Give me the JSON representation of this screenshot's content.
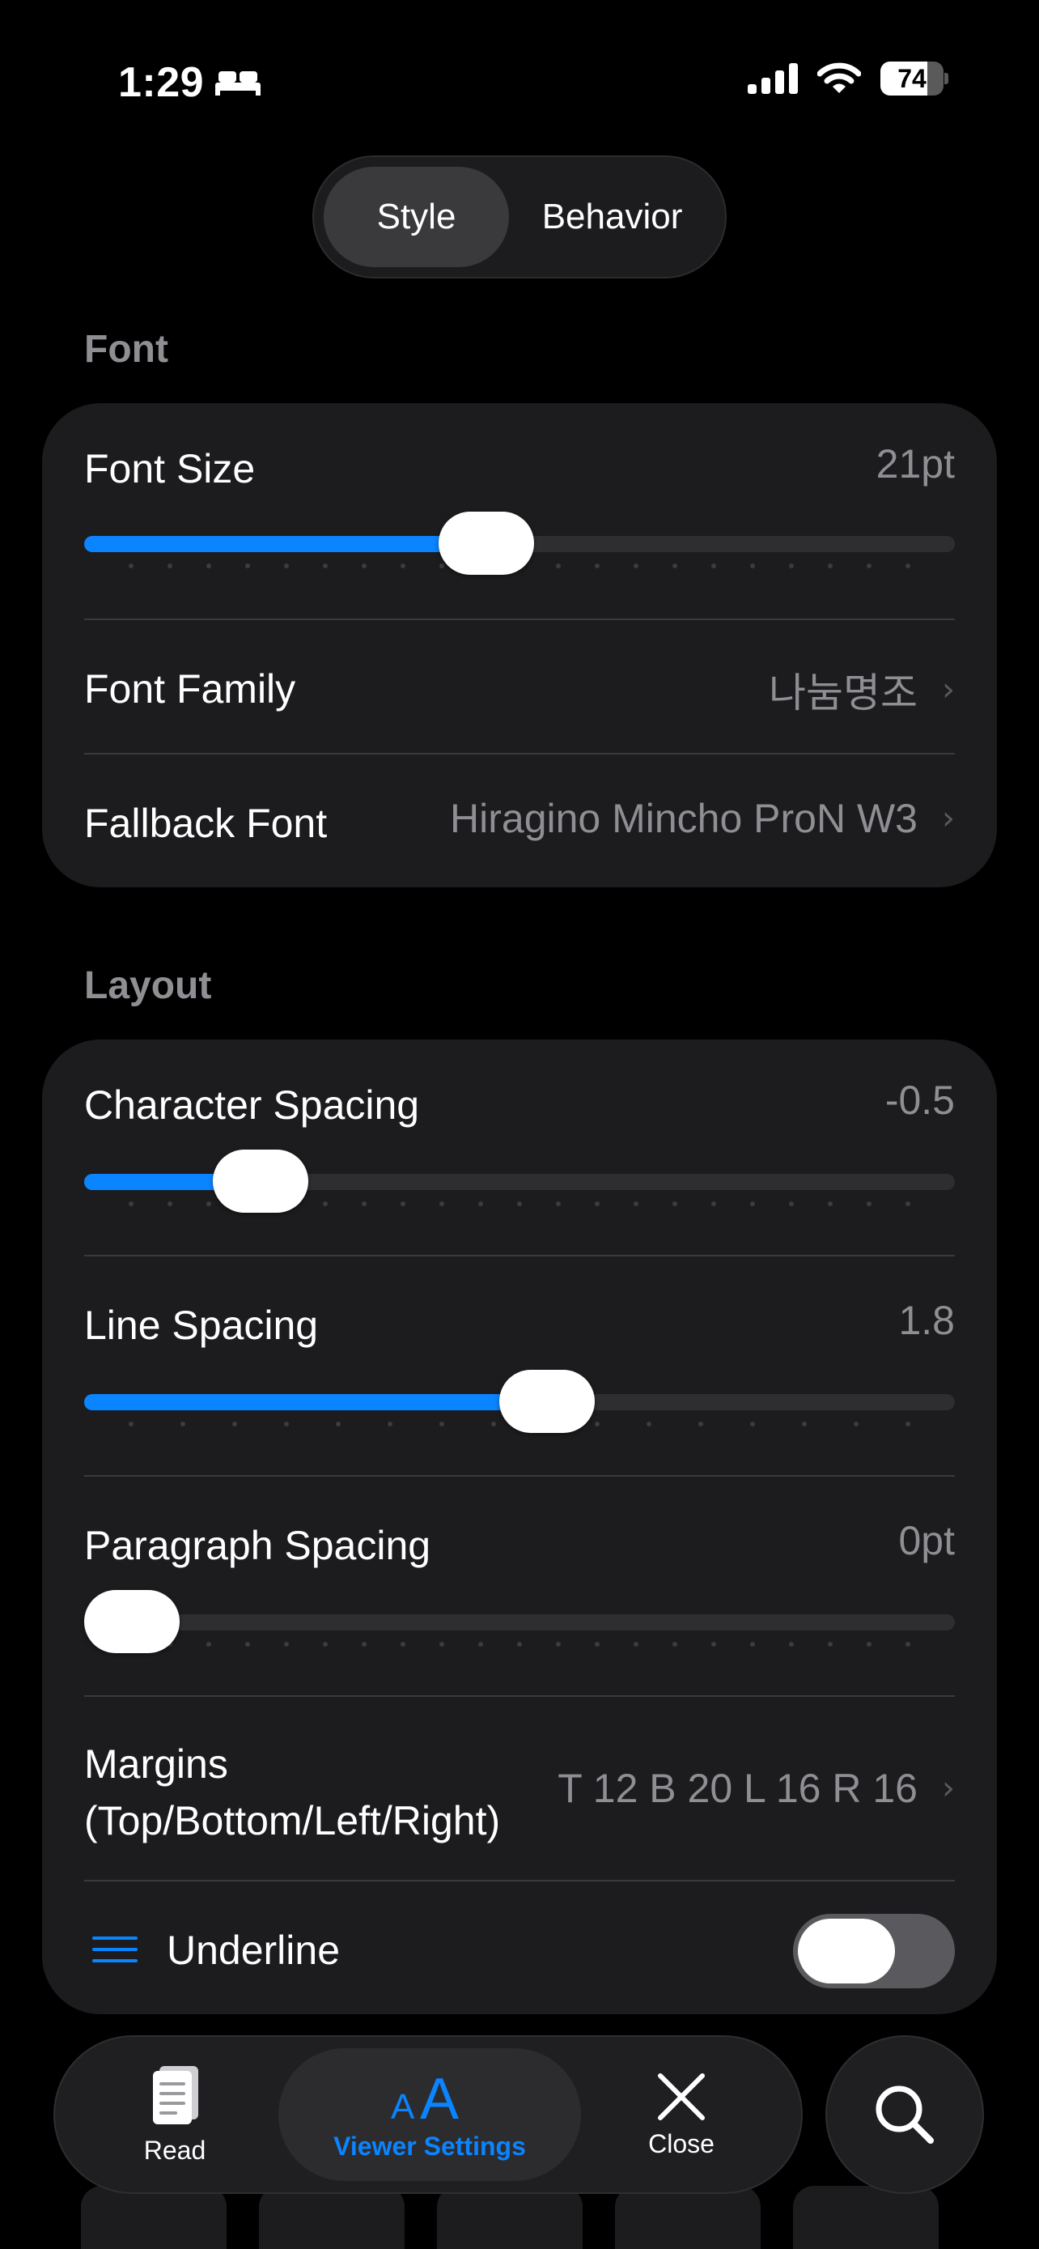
{
  "status_bar": {
    "time": "1:29",
    "battery_level": "74",
    "battery_fraction": 0.74
  },
  "segmented": {
    "style_label": "Style",
    "behavior_label": "Behavior",
    "selected": "Style"
  },
  "font_section": {
    "title": "Font",
    "font_size": {
      "label": "Font Size",
      "value": "21pt",
      "slider_fraction": 0.457,
      "tick_count": 21
    },
    "font_family": {
      "label": "Font Family",
      "value": "나눔명조"
    },
    "fallback_font": {
      "label": "Fallback Font",
      "value": "Hiragino Mincho ProN W3"
    }
  },
  "layout_section": {
    "title": "Layout",
    "character_spacing": {
      "label": "Character Spacing",
      "value": "-0.5",
      "slider_fraction": 0.166,
      "tick_count": 21
    },
    "line_spacing": {
      "label": "Line Spacing",
      "value": "1.8",
      "slider_fraction": 0.535,
      "tick_count": 16
    },
    "paragraph_spacing": {
      "label": "Paragraph Spacing",
      "value": "0pt",
      "slider_fraction": 0.0,
      "tick_count": 21
    },
    "margins": {
      "label": "Margins (Top/Bottom/Left/Right)",
      "value": "T 12 B 20 L 16 R 16"
    },
    "underline": {
      "label": "Underline",
      "enabled": false
    }
  },
  "tabbar": {
    "read_label": "Read",
    "viewer_settings_label": "Viewer Settings",
    "close_label": "Close",
    "active": "Viewer Settings"
  },
  "colors": {
    "accent": "#0a84ff",
    "card": "#1c1c1e",
    "secondary_text": "#8e8e93"
  }
}
